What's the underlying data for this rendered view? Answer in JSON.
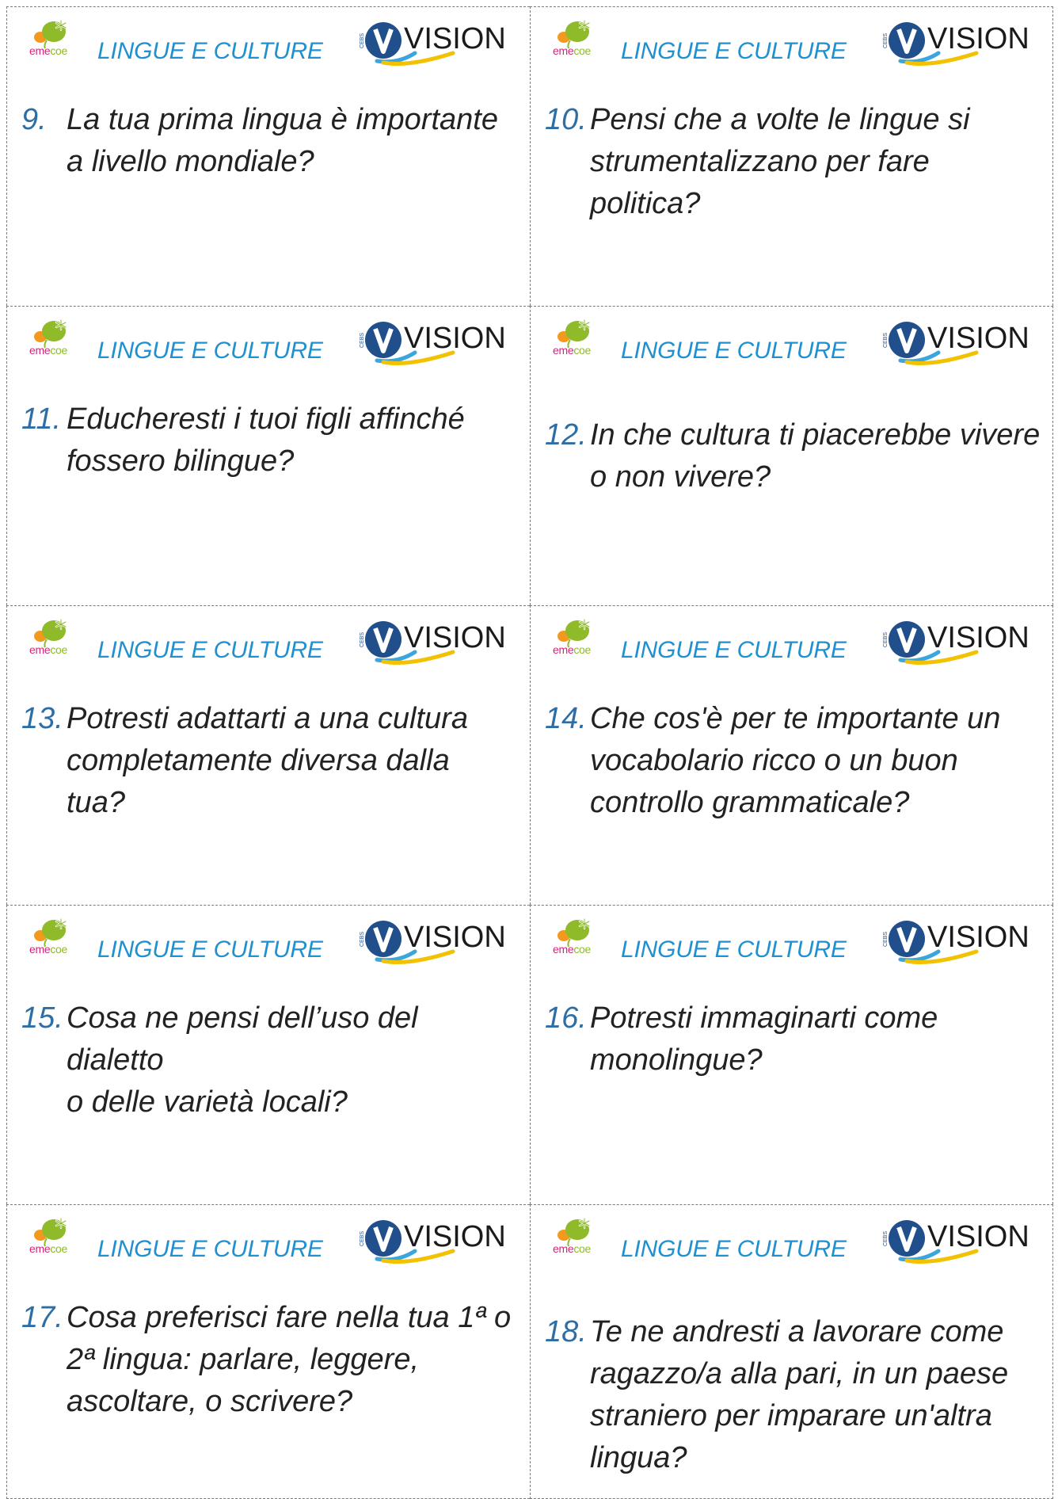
{
  "header": {
    "title": "LINGUE E CULTURE",
    "emecoe_logo_eme": "eme",
    "emecoe_logo_coe": "coe",
    "vision_logo_text": "VISION",
    "vision_logo_side_text": "CEBS"
  },
  "colors": {
    "header_title": "#1f90d0",
    "question_number": "#2d6ea6",
    "question_text": "#222222",
    "emecoe_green": "#8fba2a",
    "emecoe_orange": "#f39a1e",
    "emecoe_pink": "#d0257b",
    "vision_blue": "#214f8c",
    "vision_yellow": "#f2c200",
    "vision_cyan": "#3aa6dd"
  },
  "cards": [
    {
      "number": "9.",
      "lines": [
        "La tua prima lingua è importante",
        "a livello mondiale?"
      ]
    },
    {
      "number": "10.",
      "lines": [
        "Pensi che a volte le lingue si",
        "strumentalizzano per fare",
        "politica?"
      ]
    },
    {
      "number": "11.",
      "lines": [
        "Educheresti i tuoi figli affinché",
        "fossero bilingue?"
      ]
    },
    {
      "number": "12.",
      "lines": [
        "In che cultura ti piacerebbe vivere",
        "o non vivere?"
      ]
    },
    {
      "number": "13.",
      "lines": [
        "Potresti adattarti a una cultura",
        "completamente diversa  dalla",
        "tua?"
      ]
    },
    {
      "number": "14.",
      "lines": [
        "Che cos'è per te importante un",
        "vocabolario ricco o un buon",
        "controllo grammaticale?"
      ]
    },
    {
      "number": "15.",
      "lines": [
        "Cosa ne pensi dell’uso del dialetto",
        "o delle varietà locali?"
      ]
    },
    {
      "number": "16.",
      "lines": [
        "Potresti immaginarti come",
        "monolingue?"
      ]
    },
    {
      "number": "17.",
      "lines": [
        "Cosa preferisci fare nella tua 1ª o",
        "2ª lingua: parlare, leggere,",
        "ascoltare, o scrivere?"
      ]
    },
    {
      "number": "18.",
      "lines": [
        "Te ne andresti a lavorare come",
        "ragazzo/a alla pari, in un paese",
        "straniero per imparare un'altra",
        "lingua?"
      ]
    }
  ]
}
